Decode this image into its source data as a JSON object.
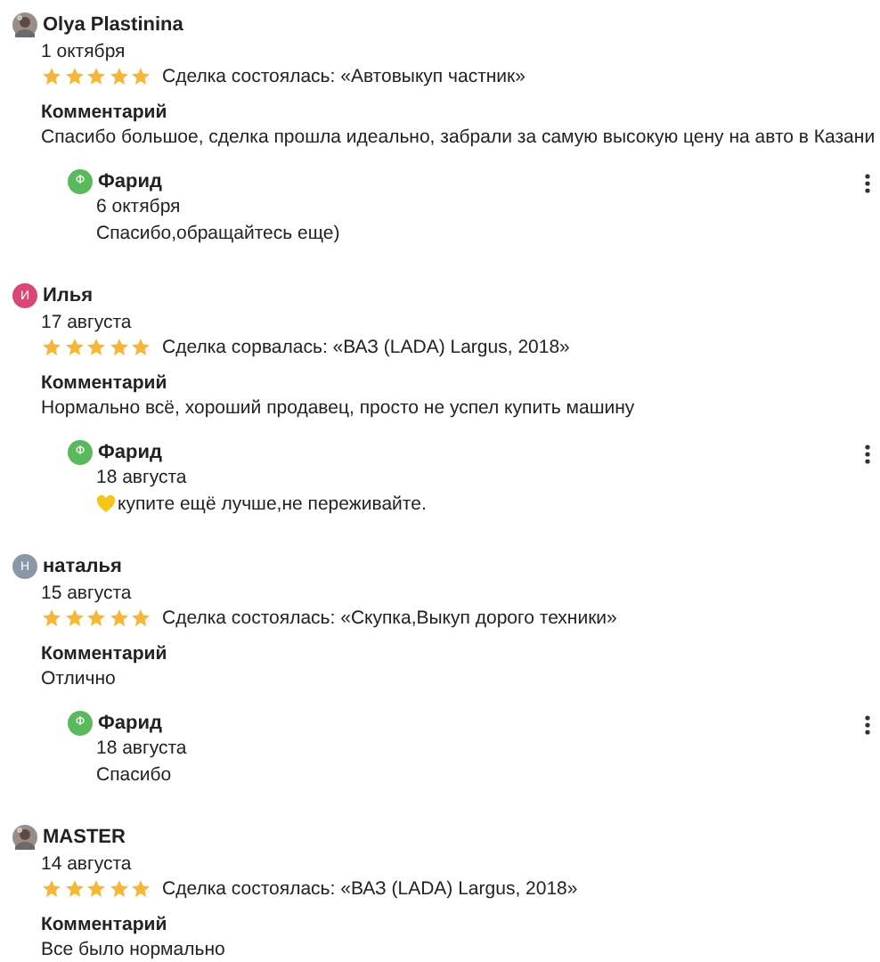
{
  "reviews": [
    {
      "author": "Olya Plastinina",
      "date": "1 октября",
      "stars": 5,
      "deal": "Сделка состоялась: «Автовыкуп частник»",
      "comment_label": "Комментарий",
      "comment": "Спасибо большое, сделка прошла идеально, забрали за самую высокую цену на авто в Казани",
      "reply": {
        "author": "Фарид",
        "avatar": {
          "kind": "letter",
          "letter": "Ф",
          "color": "#5cb85c"
        },
        "date": "6 октября",
        "text": "Спасибо,обращайтесь еще)",
        "kind": "plain"
      }
    },
    {
      "author": "Илья",
      "avatar": {
        "kind": "letter",
        "letter": "И",
        "color": "#d9467a"
      },
      "date": "17 августа",
      "stars": 5,
      "deal": "Сделка сорвалась: «ВАЗ (LADA) Largus, 2018»",
      "comment_label": "Комментарий",
      "comment": "Нормально всё, хороший продавец, просто не успел купить машину",
      "reply": {
        "author": "Фарид",
        "avatar": {
          "kind": "letter",
          "letter": "Ф",
          "color": "#5cb85c"
        },
        "date": "18 августа",
        "text": "купите ещё лучше,не переживайте.",
        "kind": "with_icon"
      }
    },
    {
      "author": "наталья",
      "avatar": {
        "kind": "letter",
        "letter": "Н",
        "color": "#8a97a8"
      },
      "date": "15 августа",
      "stars": 5,
      "deal": "Сделка состоялась: «Скупка,Выкуп дорого техники»",
      "comment_label": "Комментарий",
      "comment": "Отлично",
      "reply": {
        "author": "Фарид",
        "avatar": {
          "kind": "letter",
          "letter": "Ф",
          "color": "#5cb85c"
        },
        "date": "18 августа",
        "text": "Спасибо",
        "kind": "plain"
      }
    },
    {
      "author": "MASTER",
      "date": "14 августа",
      "stars": 5,
      "deal": "Сделка состоялась: «ВАЗ (LADA) Largus, 2018»",
      "comment_label": "Комментарий",
      "comment": "Все было нормально"
    }
  ]
}
